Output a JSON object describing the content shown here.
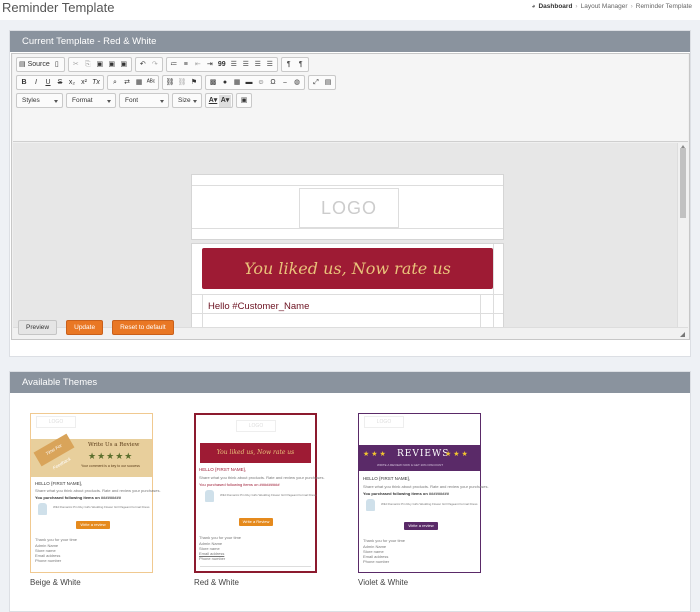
{
  "page_title": "Reminder Template",
  "breadcrumb": [
    "Dashboard",
    "Layout Manager",
    "Reminder Template"
  ],
  "current_panel": {
    "title": "Current Template - Red & White"
  },
  "toolbar": {
    "source": "Source",
    "styles": "Styles",
    "format": "Format",
    "font": "Font",
    "size": "Size",
    "bold": "B",
    "italic": "I",
    "underline": "U",
    "strike": "S",
    "subscript": "x₂",
    "superscript": "x²",
    "remove_format": "Tx",
    "undo": "↶",
    "redo": "↷",
    "blockquote": "99",
    "ltr": "¶",
    "rtl": "¶",
    "special_char": "Ω",
    "maximize": "⤢"
  },
  "editor": {
    "logo": "LOGO",
    "banner": "You liked us, Now rate us",
    "greeting": "Hello #Customer_Name"
  },
  "buttons": {
    "preview": "Preview",
    "update": "Update",
    "reset": "Reset to default"
  },
  "themes_panel": {
    "title": "Available Themes"
  },
  "themes": [
    {
      "name": "Beige & White",
      "logo": "LOGO",
      "headline": "Write Us a Review",
      "tagline": "Your comment is a key to our success",
      "ribbon": "Time For Feedback",
      "stars": "★★★★★",
      "hello": "HELLO {FIRST NAME},",
      "text1": "Share what you think about products. Rate and review your purchases.",
      "text2": "You purchased following items on #########",
      "item": "Wild Romantic Pin Ruy Girls Wedding Flower Girl Pageant Formal Dress",
      "cta": "Write a review",
      "footer": "Thank you for your time",
      "sig1": "Admin Name",
      "sig2": "Store name",
      "sig3": "Email address",
      "sig4": "Phone number",
      "accent": "#e8cf9c"
    },
    {
      "name": "Red & White",
      "logo": "LOGO",
      "banner": "You liked us, Now rate us",
      "hello": "HELLO {FIRST NAME},",
      "text1": "Share what you think about products. Rate and review your purchases.",
      "text2": "You purchased following items on #########",
      "item": "Wild Romantic Pin Ruy Girls Wedding Flower Girl Pageant Formal Dress",
      "cta": "Write a Review",
      "footer": "Thank you for your time",
      "sig1": "Admin Name",
      "sig2": "Store name",
      "sig3": "Email address",
      "sig4": "Phone number",
      "accent": "#9e1b34"
    },
    {
      "name": "Violet & White",
      "logo": "LOGO",
      "headline": "REVIEWS",
      "stars": "★ ★ ★",
      "subline": "WRITE A REVIEW NOW & GET 20% DISCOUNT",
      "hello": "HELLO {FIRST NAME},",
      "text1": "Share what you think about products. Rate and review your purchases.",
      "text2": "You purchased following items on #########",
      "item": "Wild Romantic Pin Ruy Girls Wedding Flower Girl Pageant Formal Dress",
      "cta": "Write a review",
      "footer": "Thank you for your time",
      "sig1": "Admin Name",
      "sig2": "Store name",
      "sig3": "Email address",
      "sig4": "Phone number",
      "accent": "#5a2a68"
    }
  ]
}
